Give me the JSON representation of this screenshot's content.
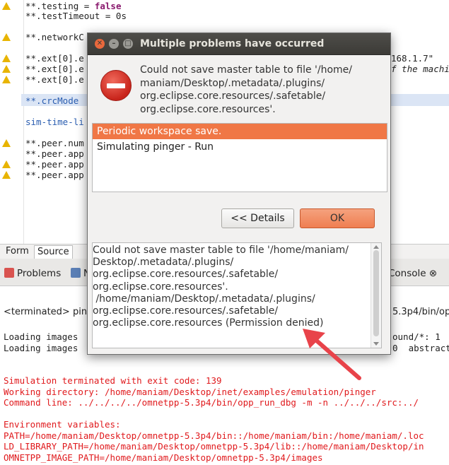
{
  "editor": {
    "lines": [
      {
        "prefix": "**.testing = ",
        "keyword": "false",
        "rest": "",
        "warn": true
      },
      {
        "prefix": "**.testTimeout = 0s",
        "keyword": "",
        "rest": "",
        "warn": false
      },
      {
        "prefix": "**.networkC",
        "keyword": "",
        "rest": "",
        "warn": true
      },
      {
        "prefix": "**.ext[0].e",
        "keyword": "",
        "rest": "",
        "warn": true
      },
      {
        "prefix": "**.ext[0].e",
        "keyword": "",
        "rest": "",
        "warn": true
      },
      {
        "prefix": "**.ext[0].e",
        "keyword": "",
        "rest": "",
        "warn": true
      },
      {
        "prefix": "**.crcMode",
        "keyword": "",
        "rest": "",
        "warn": false
      },
      {
        "prefix": "sim-time-li",
        "keyword": "",
        "rest": "",
        "warn": false
      },
      {
        "prefix": "**.peer.num",
        "keyword": "",
        "rest": "",
        "warn": true
      },
      {
        "prefix": "**.peer.app",
        "keyword": "",
        "rest": "",
        "warn": false
      },
      {
        "prefix": "**.peer.app",
        "keyword": "",
        "rest": "",
        "warn": true
      },
      {
        "prefix": "**.peer.app",
        "keyword": "",
        "rest": "",
        "warn": true
      }
    ],
    "right_string": "168.1.7\"",
    "right_comment": "f the machi"
  },
  "form_tabs": {
    "form": "Form",
    "source": "Source"
  },
  "view_tabs": {
    "problems": "Problems",
    "second": "N",
    "console": "Console"
  },
  "terminated_line": "<terminated> ping",
  "terminated_right": "5.3p4/bin/op",
  "console": {
    "loading1": "Loading images",
    "loading1_right": "ound/*: 1",
    "loading2": "Loading images",
    "loading2_right": "0  abstract",
    "red_lines": [
      "Simulation terminated with exit code: 139",
      "Working directory: /home/maniam/Desktop/inet/examples/emulation/pinger",
      "Command line: ../../../../omnetpp-5.3p4/bin/opp_run_dbg -m -n ../../../src:../",
      "",
      "Environment variables:",
      "PATH=/home/maniam/Desktop/omnetpp-5.3p4/bin::/home/maniam/bin:/home/maniam/.loc",
      "LD_LIBRARY_PATH=/home/maniam/Desktop/omnetpp-5.3p4/lib::/home/maniam/Desktop/in",
      "OMNETPP_IMAGE_PATH=/home/maniam/Desktop/omnetpp-5.3p4/images"
    ]
  },
  "dialog": {
    "title": "Multiple problems have occurred",
    "message": "Could not save master table to file '/home/\nmaniam/Desktop/.metadata/.plugins/\norg.eclipse.core.resources/.safetable/\norg.eclipse.core.resources'.",
    "problems": [
      "Periodic workspace save.",
      "Simulating pinger - Run"
    ],
    "details_button": "<< Details",
    "ok_button": "OK",
    "details_text": "Could not save master table to file '/home/maniam/\nDesktop/.metadata/.plugins/\norg.eclipse.core.resources/.safetable/\norg.eclipse.core.resources'.\n /home/maniam/Desktop/.metadata/.plugins/\norg.eclipse.core.resources/.safetable/\norg.eclipse.core.resources (Permission denied)"
  },
  "colors": {
    "accent": "#f07746",
    "console_red": "#e0191c",
    "arrow": "#e8434a"
  }
}
